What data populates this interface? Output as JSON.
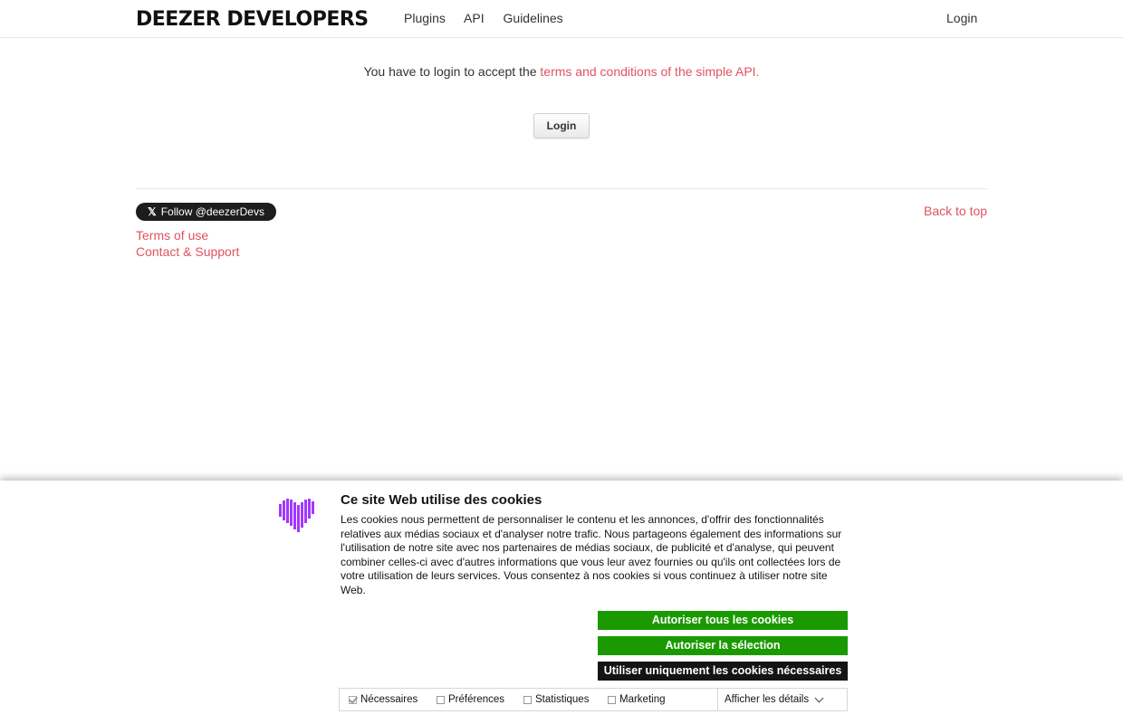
{
  "header": {
    "logo_bold": "DEEZER",
    "logo_light": "DEVELOPERS",
    "nav": [
      "Plugins",
      "API",
      "Guidelines"
    ],
    "login": "Login"
  },
  "main": {
    "message": "You have to login to accept the ",
    "message_link": "terms and conditions of the simple API.",
    "login_button": "Login"
  },
  "footer": {
    "twitter_icon": "x-icon",
    "twitter_label": "Follow @deezerDevs",
    "back_to_top": "Back to top",
    "links": [
      "Terms of use",
      "Contact & Support"
    ]
  },
  "cookie": {
    "logo_icon": "heart-logo-icon",
    "logo_color": "#a238ff",
    "title": "Ce site Web utilise des cookies",
    "text": "Les cookies nous permettent de personnaliser le contenu et les annonces, d'offrir des fonctionnalités relatives aux médias sociaux et d'analyser notre trafic. Nous partageons également des informations sur l'utilisation de notre site avec nos partenaires de médias sociaux, de publicité et d'analyse, qui peuvent combiner celles-ci avec d'autres informations que vous leur avez fournies ou qu'ils ont collectées lors de votre utilisation de leurs services. Vous consentez à nos cookies si vous continuez à utiliser notre site Web.",
    "allow_all": "Autoriser tous les cookies",
    "allow_selection": "Autoriser la sélection",
    "necessary_only": "Utiliser uniquement les cookies nécessaires",
    "checkboxes": [
      {
        "label": "Nécessaires",
        "checked": true
      },
      {
        "label": "Préférences",
        "checked": false
      },
      {
        "label": "Statistiques",
        "checked": false
      },
      {
        "label": "Marketing",
        "checked": false
      }
    ],
    "details": "Afficher les détails"
  }
}
